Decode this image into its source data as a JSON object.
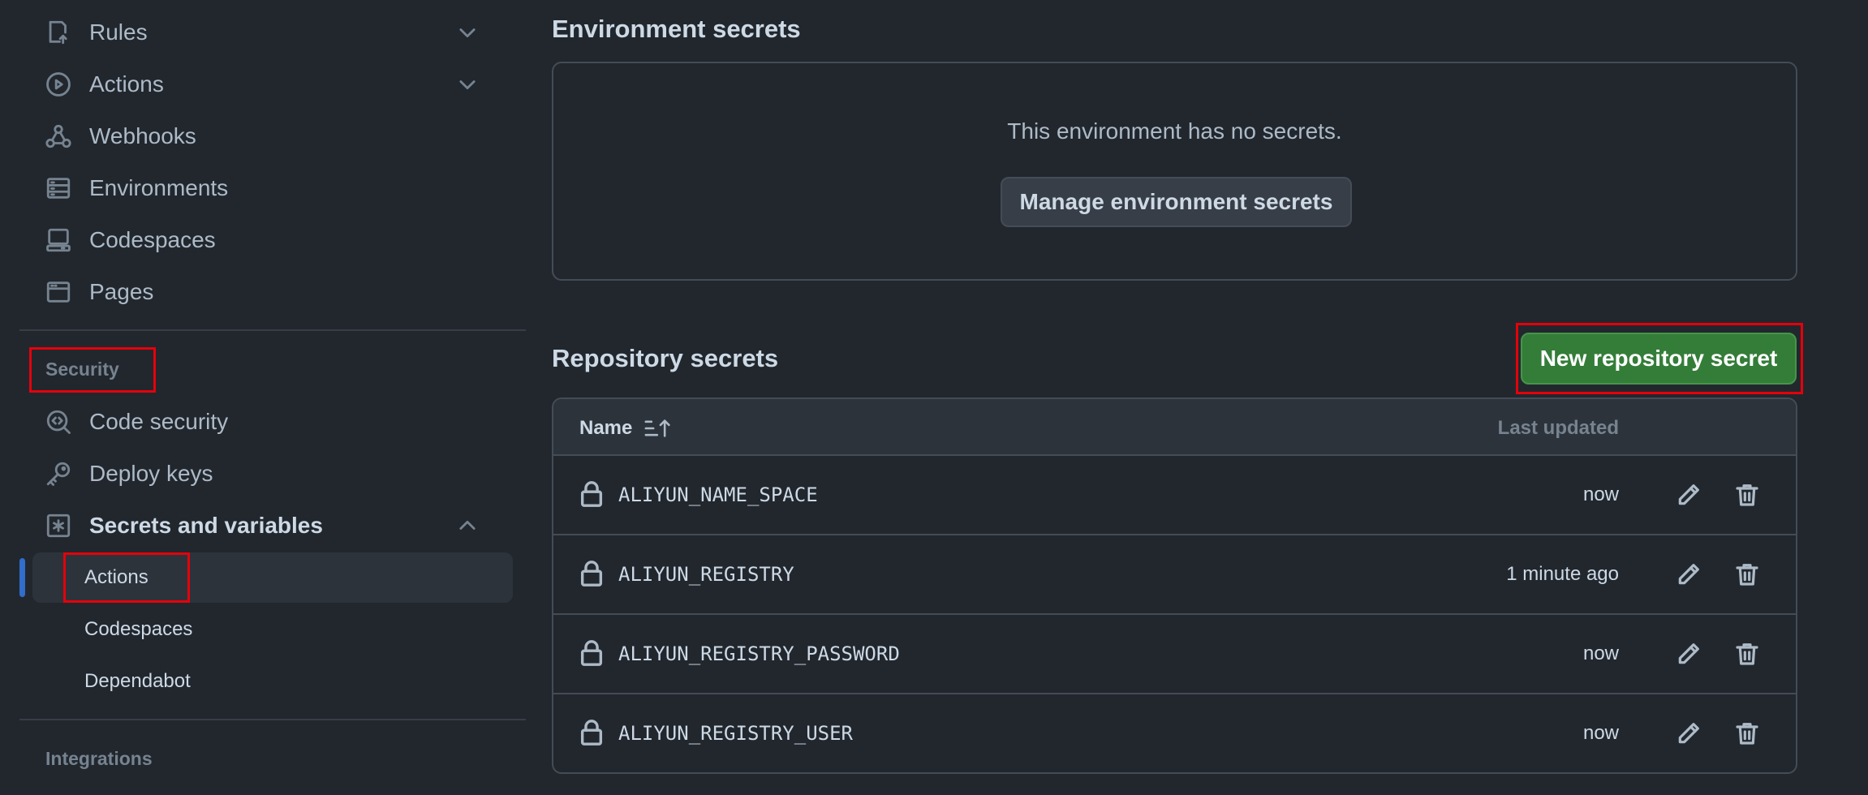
{
  "sidebar": {
    "items": [
      {
        "label": "Rules",
        "icon": "rules-icon"
      },
      {
        "label": "Actions",
        "icon": "play-icon"
      },
      {
        "label": "Webhooks",
        "icon": "webhook-icon"
      },
      {
        "label": "Environments",
        "icon": "server-icon"
      },
      {
        "label": "Codespaces",
        "icon": "codespaces-icon"
      },
      {
        "label": "Pages",
        "icon": "browser-icon"
      }
    ],
    "security_heading": "Security",
    "security_items": [
      {
        "label": "Code security",
        "icon": "codescan-icon"
      },
      {
        "label": "Deploy keys",
        "icon": "key-icon"
      },
      {
        "label": "Secrets and variables",
        "icon": "asterisk-icon"
      }
    ],
    "secrets_subitems": [
      {
        "label": "Actions",
        "active": true
      },
      {
        "label": "Codespaces",
        "active": false
      },
      {
        "label": "Dependabot",
        "active": false
      }
    ],
    "integrations_heading": "Integrations"
  },
  "environment_secrets": {
    "heading": "Environment secrets",
    "empty_text": "This environment has no secrets.",
    "manage_button": "Manage environment secrets"
  },
  "repository_secrets": {
    "heading": "Repository secrets",
    "new_button": "New repository secret",
    "columns": {
      "name": "Name",
      "last_updated": "Last updated"
    },
    "rows": [
      {
        "name": "ALIYUN_NAME_SPACE",
        "updated": "now"
      },
      {
        "name": "ALIYUN_REGISTRY",
        "updated": "1 minute ago"
      },
      {
        "name": "ALIYUN_REGISTRY_PASSWORD",
        "updated": "now"
      },
      {
        "name": "ALIYUN_REGISTRY_USER",
        "updated": "now"
      }
    ]
  },
  "colors": {
    "background": "#22272e",
    "primary_button": "#347d39",
    "active_indicator": "#316dca",
    "highlight_box": "#e5000b"
  }
}
